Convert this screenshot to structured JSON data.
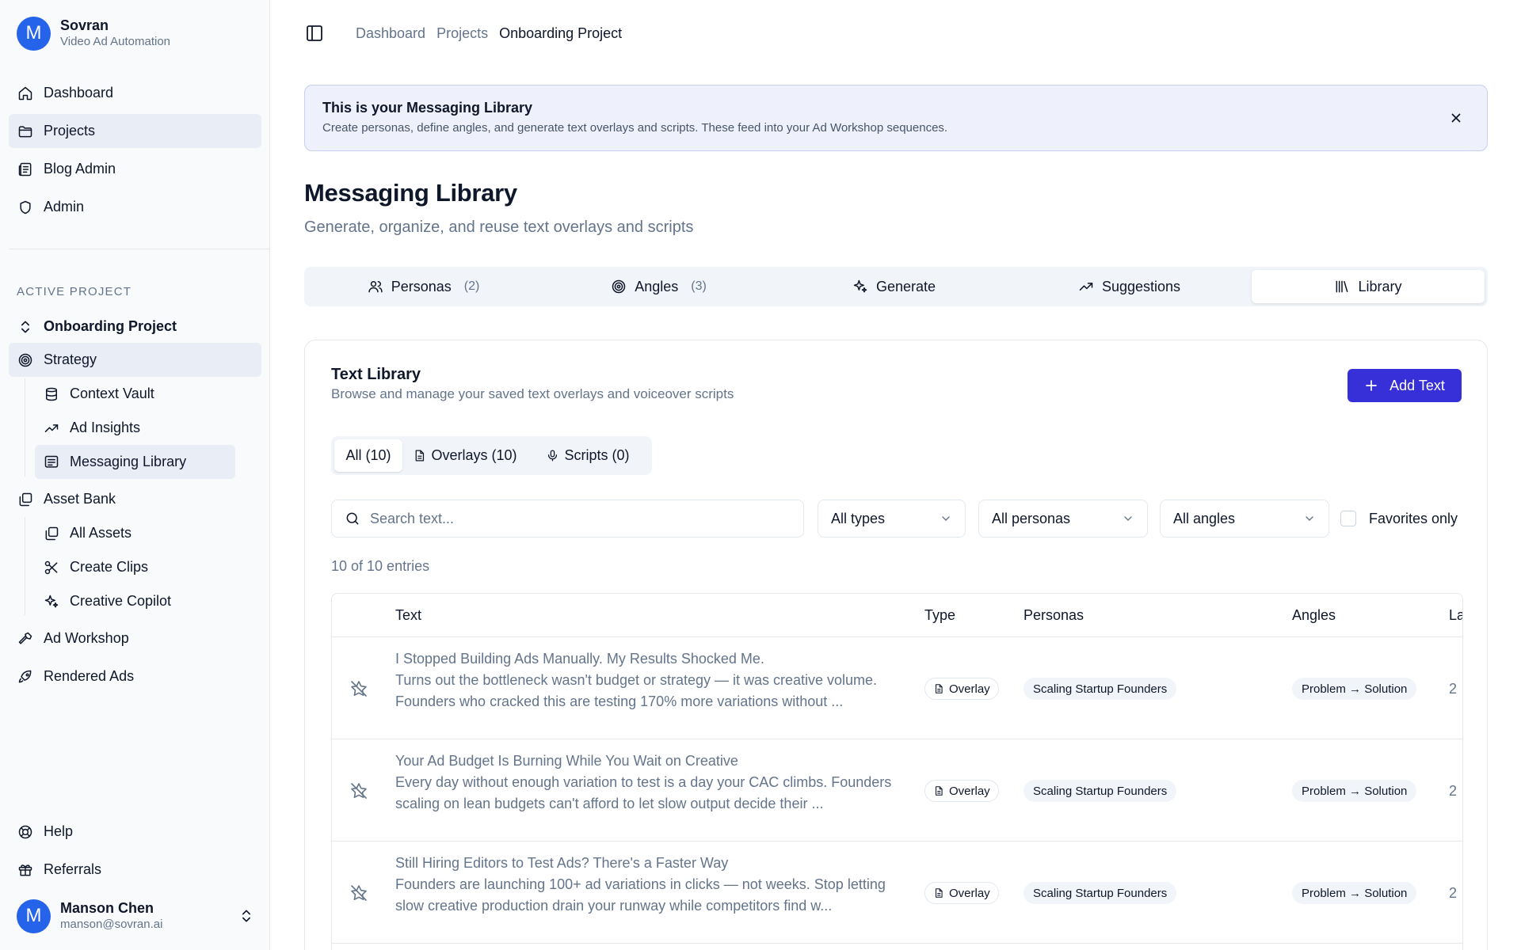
{
  "app": {
    "name": "Sovran",
    "subtitle": "Video Ad Automation",
    "avatar_letter": "M",
    "accent": "#3730d9",
    "avatar_color": "#2563eb"
  },
  "sidebar": {
    "main_nav": [
      {
        "label": "Dashboard",
        "icon": "home-icon"
      },
      {
        "label": "Projects",
        "icon": "folder-icon",
        "active": true
      },
      {
        "label": "Blog Admin",
        "icon": "newspaper-icon"
      },
      {
        "label": "Admin",
        "icon": "shield-icon"
      }
    ],
    "section_label": "ACTIVE PROJECT",
    "project_name": "Onboarding Project",
    "strategy_label": "Strategy",
    "strategy_items": [
      {
        "label": "Context Vault",
        "icon": "database-icon"
      },
      {
        "label": "Ad Insights",
        "icon": "trending-icon"
      },
      {
        "label": "Messaging Library",
        "icon": "message-icon",
        "active": true
      }
    ],
    "asset_bank_label": "Asset Bank",
    "asset_items": [
      {
        "label": "All Assets",
        "icon": "gallery-icon"
      },
      {
        "label": "Create Clips",
        "icon": "scissors-icon"
      },
      {
        "label": "Creative Copilot",
        "icon": "sparkles-icon"
      }
    ],
    "ad_workshop_label": "Ad Workshop",
    "rendered_ads_label": "Rendered Ads",
    "help_label": "Help",
    "referrals_label": "Referrals"
  },
  "user": {
    "name": "Manson Chen",
    "email": "manson@sovran.ai",
    "avatar_letter": "M"
  },
  "breadcrumb": {
    "items": [
      "Dashboard",
      "Projects"
    ],
    "current": "Onboarding Project"
  },
  "banner": {
    "title": "This is your Messaging Library",
    "text": "Create personas, define angles, and generate text overlays and scripts. These feed into your Ad Workshop sequences."
  },
  "page": {
    "title": "Messaging Library",
    "subtitle": "Generate, organize, and reuse text overlays and scripts"
  },
  "tabs": [
    {
      "label": "Personas",
      "count": "(2)"
    },
    {
      "label": "Angles",
      "count": "(3)"
    },
    {
      "label": "Generate"
    },
    {
      "label": "Suggestions"
    },
    {
      "label": "Library",
      "active": true
    }
  ],
  "library": {
    "title": "Text Library",
    "subtitle": "Browse and manage your saved text overlays and voiceover scripts",
    "add_label": "Add Text",
    "segments": [
      "All (10)",
      "Overlays (10)",
      "Scripts (0)"
    ],
    "search_placeholder": "Search text...",
    "filters": {
      "types": "All types",
      "personas": "All personas",
      "angles": "All angles"
    },
    "favorites_label": "Favorites only",
    "entries": "10 of 10 entries",
    "columns": {
      "text": "Text",
      "type": "Type",
      "personas": "Personas",
      "angles": "Angles",
      "lang": "La"
    },
    "rows": [
      {
        "text": "I Stopped Building Ads Manually. My Results Shocked Me.\nTurns out the bottleneck wasn't budget or strategy — it was creative volume. Founders who cracked this are testing 170% more variations without ...",
        "type": "Overlay",
        "persona": "Scaling Startup Founders",
        "angle": "Problem → Solution",
        "lang": "2"
      },
      {
        "text": "Your Ad Budget Is Burning While You Wait on Creative\nEvery day without enough variation to test is a day your CAC climbs. Founders scaling on lean budgets can't afford to let slow output decide their ...",
        "type": "Overlay",
        "persona": "Scaling Startup Founders",
        "angle": "Problem → Solution",
        "lang": "2"
      },
      {
        "text": "Still Hiring Editors to Test Ads? There's a Faster Way\nFounders are launching 100+ ad variations in clicks — not weeks. Stop letting slow creative production drain your runway while competitors find w...",
        "type": "Overlay",
        "persona": "Scaling Startup Founders",
        "angle": "Problem → Solution",
        "lang": "2"
      }
    ]
  }
}
